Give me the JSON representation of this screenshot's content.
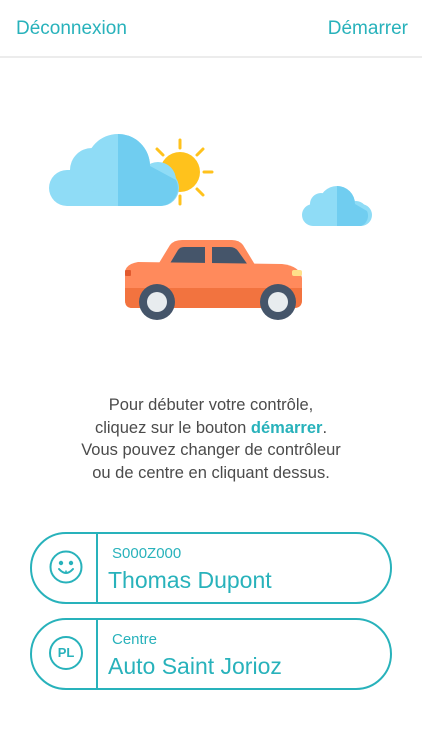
{
  "header": {
    "logout_label": "Déconnexion",
    "start_label": "Démarrer"
  },
  "message": {
    "line1": "Pour débuter votre contrôle,",
    "line2_before": "cliquez sur le bouton ",
    "line2_highlight": "démarrer",
    "line2_after": ".",
    "line3": "Vous pouvez changer de contrôleur",
    "line4": "ou de centre en cliquant dessus."
  },
  "controller": {
    "code": "S000Z000",
    "name": "Thomas Dupont",
    "icon": "smiley-face-icon"
  },
  "center": {
    "label": "Centre",
    "name": "Auto Saint Jorioz",
    "badge": "PL",
    "icon": "pl-badge-icon"
  },
  "colors": {
    "accent": "#28b2bb",
    "text": "#4b4b4b",
    "car": "#ff8a5c",
    "cloud": "#8fdcf6",
    "sun": "#ffc21c"
  }
}
